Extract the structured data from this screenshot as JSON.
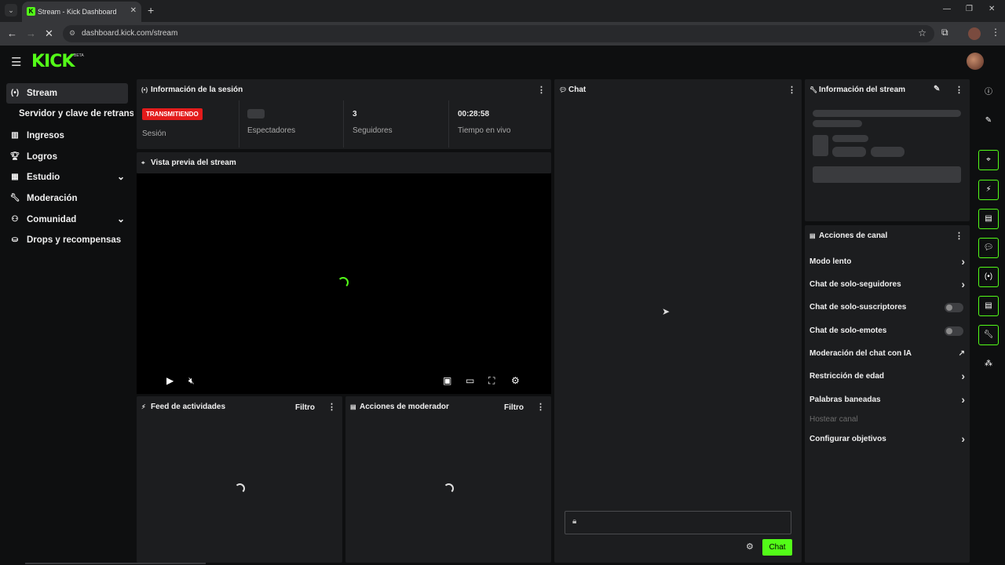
{
  "browser": {
    "tab_title": "Stream - Kick Dashboard",
    "tab_favicon": "K",
    "url": "dashboard.kick.com/stream"
  },
  "app": {
    "logo": "KICK",
    "logo_badge": "BETA",
    "accent": "#53fc18"
  },
  "sidebar": {
    "items": [
      {
        "label": "Stream",
        "icon": "broadcast-icon"
      },
      {
        "label": "Ingresos",
        "icon": "chart-icon"
      },
      {
        "label": "Logros",
        "icon": "trophy-icon"
      },
      {
        "label": "Estudio",
        "icon": "studio-icon"
      },
      {
        "label": "Moderación",
        "icon": "wrench-icon"
      },
      {
        "label": "Comunidad",
        "icon": "community-icon"
      },
      {
        "label": "Drops y recompensas",
        "icon": "drops-icon"
      }
    ],
    "sub_item": "Servidor y clave de retransmisión"
  },
  "session": {
    "title": "Información de la sesión",
    "status_badge": "TRANSMITIENDO",
    "status_label": "Sesión",
    "viewers_label": "Espectadores",
    "followers_value": "3",
    "followers_label": "Seguidores",
    "live_time_value": "00:28:58",
    "live_time_label": "Tiempo en vivo"
  },
  "preview": {
    "title": "Vista previa del stream"
  },
  "feed": {
    "title": "Feed de actividades",
    "filter": "Filtro"
  },
  "mod_actions": {
    "title": "Acciones de moderador",
    "filter": "Filtro"
  },
  "chat": {
    "title": "Chat",
    "send_label": "Chat"
  },
  "stream_info": {
    "title": "Información del stream"
  },
  "channel_actions": {
    "title": "Acciones de canal",
    "items": [
      {
        "label": "Modo lento",
        "control": "arrow"
      },
      {
        "label": "Chat de solo-seguidores",
        "control": "arrow"
      },
      {
        "label": "Chat de solo-suscriptores",
        "control": "toggle"
      },
      {
        "label": "Chat de solo-emotes",
        "control": "toggle"
      },
      {
        "label": "Moderación del chat con IA",
        "control": "external"
      },
      {
        "label": "Restricción de edad",
        "control": "arrow"
      },
      {
        "label": "Palabras baneadas",
        "control": "arrow"
      },
      {
        "label": "Hostear canal",
        "control": "none"
      },
      {
        "label": "Configurar objetivos",
        "control": "arrow"
      }
    ]
  }
}
